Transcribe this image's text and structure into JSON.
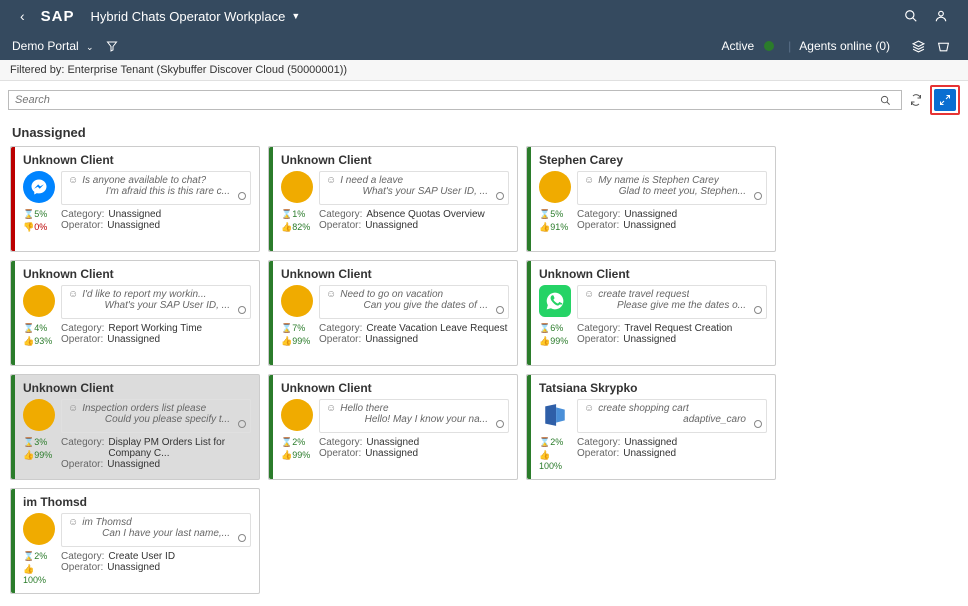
{
  "header": {
    "logo": "SAP",
    "title": "Hybrid Chats Operator Workplace"
  },
  "subheader": {
    "portal": "Demo Portal",
    "status": "Active",
    "agents": "Agents online (0)"
  },
  "filter_text": "Filtered by: Enterprise Tenant (Skybuffer Discover Cloud (50000001))",
  "search": {
    "placeholder": "Search"
  },
  "section_title": "Unassigned",
  "cards": [
    {
      "title": "Unknown Client",
      "avatar": "messenger",
      "stripe": "red",
      "msg1": "Is anyone available to chat?",
      "msg2": "I'm afraid this is this rare c...",
      "stat1": "⌛5%",
      "stat1c": "green",
      "stat2": "👎0%",
      "stat2c": "red",
      "category": "Unassigned",
      "operator": "Unassigned",
      "selected": false
    },
    {
      "title": "Unknown Client",
      "avatar": "yellow",
      "stripe": "green",
      "msg1": "I need a leave",
      "msg2": "What's your SAP User ID, ...",
      "stat1": "⌛1%",
      "stat1c": "green",
      "stat2": "👍82%",
      "stat2c": "green",
      "category": "Absence Quotas Overview",
      "operator": "Unassigned",
      "selected": false
    },
    {
      "title": "Stephen Carey",
      "avatar": "yellow",
      "stripe": "green",
      "msg1": "My name is Stephen Carey",
      "msg2": "Glad to meet you, Stephen...",
      "stat1": "⌛5%",
      "stat1c": "green",
      "stat2": "👍91%",
      "stat2c": "green",
      "category": "Unassigned",
      "operator": "Unassigned",
      "selected": false
    },
    {
      "title": "Unknown Client",
      "avatar": "yellow",
      "stripe": "green",
      "msg1": "I'd like to report my workin...",
      "msg2": "What's your SAP User ID, ...",
      "stat1": "⌛4%",
      "stat1c": "green",
      "stat2": "👍93%",
      "stat2c": "green",
      "category": "Report Working Time",
      "operator": "Unassigned",
      "selected": false
    },
    {
      "title": "Unknown Client",
      "avatar": "yellow",
      "stripe": "green",
      "msg1": "Need to go on vacation",
      "msg2": "Can you give the dates of ...",
      "stat1": "⌛7%",
      "stat1c": "green",
      "stat2": "👍99%",
      "stat2c": "green",
      "category": "Create Vacation Leave Request",
      "operator": "Unassigned",
      "selected": false
    },
    {
      "title": "Unknown Client",
      "avatar": "whatsapp",
      "stripe": "green",
      "msg1": "create travel request",
      "msg2": "Please give me the dates o...",
      "stat1": "⌛6%",
      "stat1c": "green",
      "stat2": "👍99%",
      "stat2c": "green",
      "category": "Travel Request Creation",
      "operator": "Unassigned",
      "selected": false
    },
    {
      "title": "Unknown Client",
      "avatar": "yellow",
      "stripe": "green",
      "msg1": "Inspection orders list please",
      "msg2": "Could you please specify t...",
      "stat1": "⌛3%",
      "stat1c": "green",
      "stat2": "👍99%",
      "stat2c": "green",
      "category": "Display PM Orders List for Company C...",
      "operator": "Unassigned",
      "selected": true
    },
    {
      "title": "Unknown Client",
      "avatar": "yellow",
      "stripe": "green",
      "msg1": "Hello there",
      "msg2": "Hello! May I know your na...",
      "stat1": "⌛2%",
      "stat1c": "green",
      "stat2": "👍99%",
      "stat2c": "green",
      "category": "Unassigned",
      "operator": "Unassigned",
      "selected": false
    },
    {
      "title": "Tatsiana Skrypko",
      "avatar": "teams",
      "stripe": "green",
      "msg1": "create shopping cart",
      "msg2": "adaptive_caro",
      "stat1": "⌛2%",
      "stat1c": "green",
      "stat2": "👍100%",
      "stat2c": "green",
      "category": "Unassigned",
      "operator": "Unassigned",
      "selected": false
    },
    {
      "title": "im Thomsd",
      "avatar": "yellow",
      "stripe": "green",
      "msg1": "im Thomsd",
      "msg2": "Can I have your last name,...",
      "stat1": "⌛2%",
      "stat1c": "green",
      "stat2": "👍100%",
      "stat2c": "green",
      "category": "Create User ID",
      "operator": "Unassigned",
      "selected": false
    }
  ],
  "labels": {
    "category": "Category:",
    "operator": "Operator:"
  }
}
